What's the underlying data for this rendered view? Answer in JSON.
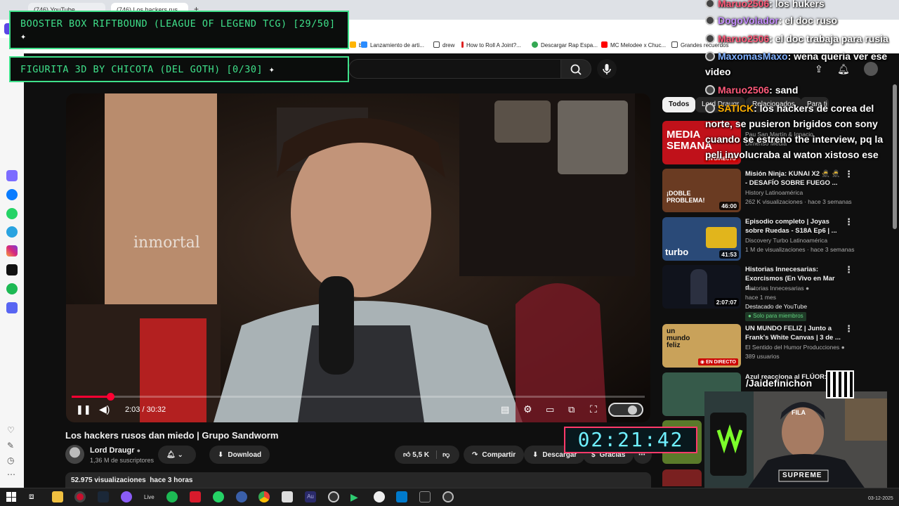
{
  "browser": {
    "tabs": [
      {
        "label": "(746) YouTube"
      },
      {
        "label": "(746) Los hackers rus..."
      }
    ],
    "bookmarks": [
      {
        "label": "Lanzamiento de arti...",
        "color": "#2a8cff"
      },
      {
        "label": "drew",
        "color": "#444444"
      },
      {
        "label": "How to Roll A Joint?...",
        "color": "#d22"
      },
      {
        "label": "Descargar Rap Espa...",
        "color": "#34a853"
      },
      {
        "label": "MC Melodee x Chuc...",
        "color": "#ff0000"
      },
      {
        "label": "Grandes recuerdos",
        "color": "#444444"
      }
    ]
  },
  "overlays": {
    "goal1": "BOOSTER BOX RIFTBOUND (LEAGUE OF LEGEND TCG) [29/50]",
    "goal2": "FIGURITA 3D BY CHICOTA (DEL GOTH) [0/30]"
  },
  "video": {
    "poster_text": "inmortal",
    "time": "2:03 / 30:32",
    "progress": 0.067
  },
  "meta": {
    "title": "Los hackers rusos dan miedo | Grupo Sandworm",
    "channel": "Lord Draugr",
    "subscribers": "1,36 M de suscriptores",
    "download": "Download",
    "likes": "5,5 K",
    "share": "Compartir",
    "save": "Descargar",
    "thanks": "Gracias",
    "views": "52.975 visualizaciones",
    "age": "hace 3 horas"
  },
  "chips": [
    "Todos",
    "Lord Draugr",
    "Relacionados",
    "Para ti"
  ],
  "recommendations": [
    {
      "title": "MEDIA SEMANA",
      "channel": "Pau San Martín & Ignacio",
      "meta": "Dimenso Media",
      "badge": "EN DIRECTO",
      "thumb": "#c0111a"
    },
    {
      "title": "Misión Ninja: KUNAI X2 🥷 🥷 - DESAFÍO SOBRE FUEGO ...",
      "channel": "History Latinoamérica",
      "meta": "262 K visualizaciones · hace 3 semanas",
      "duration": "46:00",
      "thumb": "#6a3b22",
      "thumb_text": "¡DOBLE PROBLEMA!"
    },
    {
      "title": "Episodio completo | Joyas sobre Ruedas - S18A Ep6 | ...",
      "channel": "Discovery Turbo Latinoamérica",
      "meta": "1 M de visualizaciones · hace 3 semanas",
      "duration": "41:53",
      "thumb": "#2a4a78",
      "thumb_text": "turbo"
    },
    {
      "title": "Historias Innecesarias: Exorcismos (En Vivo en Mar d...",
      "channel": "Historias Innecesarias",
      "meta": "hace 1 mes",
      "extra": "Destacado de YouTube",
      "members": "Solo para miembros",
      "duration": "2:07:07",
      "thumb": "#10131c"
    },
    {
      "title": "UN MUNDO FELIZ | Junto a Frank's White Canvas | 3 de ...",
      "channel": "El Sentido del Humor Producciones",
      "meta": "389 usuarios",
      "badge": "EN DIRECTO",
      "thumb": "#c9a25a",
      "thumb_text": "un mundo feliz"
    },
    {
      "title": "Azul reacciona al FLÚOR: el",
      "channel": "",
      "meta": "",
      "thumb": "#365a4a"
    }
  ],
  "chat": [
    {
      "user": "Maruo2506",
      "color": "#ff5a7a",
      "text": ": los hukers"
    },
    {
      "user": "DogoVolador",
      "color": "#c58cff",
      "text": ": el doc ruso"
    },
    {
      "user": "Maruo2506",
      "color": "#ff5a7a",
      "text": ": el doc trabaja para rusia"
    },
    {
      "user": "MaxomasMaxo",
      "color": "#7fb0ff",
      "text": ": wena queria ver ese video"
    },
    {
      "user": "Maruo2506",
      "color": "#ff5a7a",
      "text": ": sand"
    },
    {
      "user": "SATICK",
      "color": "#ffb000",
      "text": ": los hackers de corea del norte, se pusieron brigidos con sony cuando se estreno the interview, pq la peli involucraba al waton xistoso ese"
    }
  ],
  "timer": "02:21:42",
  "webcam": {
    "handle": "/Jaidefinichon",
    "shirt": "FILA",
    "hoodie": "SUPREME"
  },
  "taskbar": {
    "live_label": "Live",
    "date": "03-12-2025"
  }
}
